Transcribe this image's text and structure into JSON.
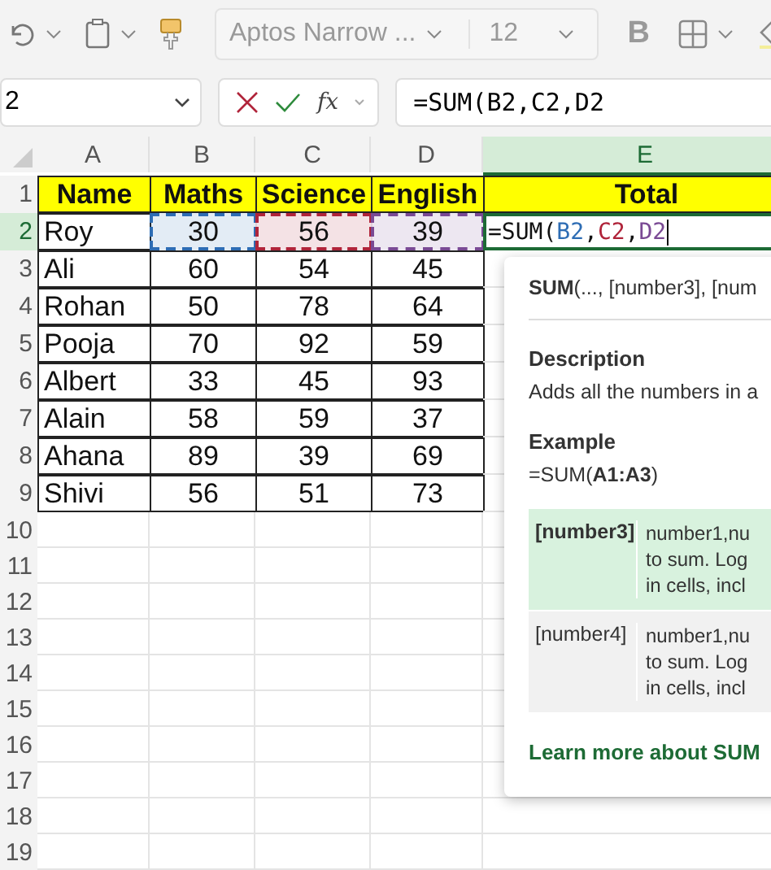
{
  "toolbar": {
    "font": "Aptos Narrow ...",
    "size": "12",
    "bold_label": "B"
  },
  "formula_bar": {
    "name_box": "2",
    "fx": "fx",
    "formula": "=SUM(B2,C2,D2"
  },
  "columns": [
    {
      "label": "A",
      "selected": false
    },
    {
      "label": "B",
      "selected": false
    },
    {
      "label": "C",
      "selected": false
    },
    {
      "label": "D",
      "selected": false
    },
    {
      "label": "E",
      "selected": true
    }
  ],
  "rows": [
    {
      "num": "1",
      "selected": false,
      "kind": "header",
      "cells": [
        "Name",
        "Maths",
        "Science",
        "English",
        "Total"
      ]
    },
    {
      "num": "2",
      "selected": true,
      "kind": "data",
      "cells": [
        "Roy",
        "30",
        "56",
        "39"
      ]
    },
    {
      "num": "3",
      "selected": false,
      "kind": "data",
      "cells": [
        "Ali",
        "60",
        "54",
        "45"
      ]
    },
    {
      "num": "4",
      "selected": false,
      "kind": "data",
      "cells": [
        "Rohan",
        "50",
        "78",
        "64"
      ]
    },
    {
      "num": "5",
      "selected": false,
      "kind": "data",
      "cells": [
        "Pooja",
        "70",
        "92",
        "59"
      ]
    },
    {
      "num": "6",
      "selected": false,
      "kind": "data",
      "cells": [
        "Albert",
        "33",
        "45",
        "93"
      ]
    },
    {
      "num": "7",
      "selected": false,
      "kind": "data",
      "cells": [
        "Alain",
        "58",
        "59",
        "37"
      ]
    },
    {
      "num": "8",
      "selected": false,
      "kind": "data",
      "cells": [
        "Ahana",
        "89",
        "39",
        "69"
      ]
    },
    {
      "num": "9",
      "selected": false,
      "kind": "data",
      "cells": [
        "Shivi",
        "56",
        "51",
        "73"
      ]
    },
    {
      "num": "10",
      "selected": false,
      "kind": "empty",
      "cells": []
    },
    {
      "num": "11",
      "selected": false,
      "kind": "empty",
      "cells": []
    },
    {
      "num": "12",
      "selected": false,
      "kind": "empty",
      "cells": []
    },
    {
      "num": "13",
      "selected": false,
      "kind": "empty",
      "cells": []
    },
    {
      "num": "14",
      "selected": false,
      "kind": "empty",
      "cells": []
    },
    {
      "num": "15",
      "selected": false,
      "kind": "empty",
      "cells": []
    },
    {
      "num": "16",
      "selected": false,
      "kind": "empty",
      "cells": []
    },
    {
      "num": "17",
      "selected": false,
      "kind": "empty",
      "cells": []
    },
    {
      "num": "18",
      "selected": false,
      "kind": "empty",
      "cells": []
    },
    {
      "num": "19",
      "selected": false,
      "kind": "empty",
      "cells": []
    }
  ],
  "editing_cell": {
    "parts": [
      {
        "text": "=SUM(",
        "color": "#111111",
        "kind": "text"
      },
      {
        "text": "B2",
        "color": "#2e6db4",
        "kind": "ref"
      },
      {
        "text": ",",
        "color": "#111111",
        "kind": "text"
      },
      {
        "text": "C2",
        "color": "#b0243a",
        "kind": "ref"
      },
      {
        "text": ",",
        "color": "#111111",
        "kind": "text"
      },
      {
        "text": "D2",
        "color": "#7a4a94",
        "kind": "ref"
      }
    ]
  },
  "tooltip": {
    "signature": "**SUM**(..., [number3], [num",
    "description_heading": "Description",
    "description": "Adds all the numbers in a",
    "example_heading": "Example",
    "example": "=SUM(**A1:A3**)",
    "params": [
      {
        "name": "[number3]",
        "selected": true,
        "lines": [
          "number1,nu",
          "to sum. Log",
          "in cells, incl"
        ]
      },
      {
        "name": "[number4]",
        "selected": false,
        "lines": [
          "number1,nu",
          "to sum. Log",
          "in cells, incl"
        ]
      }
    ],
    "link": "Learn more about SUM"
  }
}
